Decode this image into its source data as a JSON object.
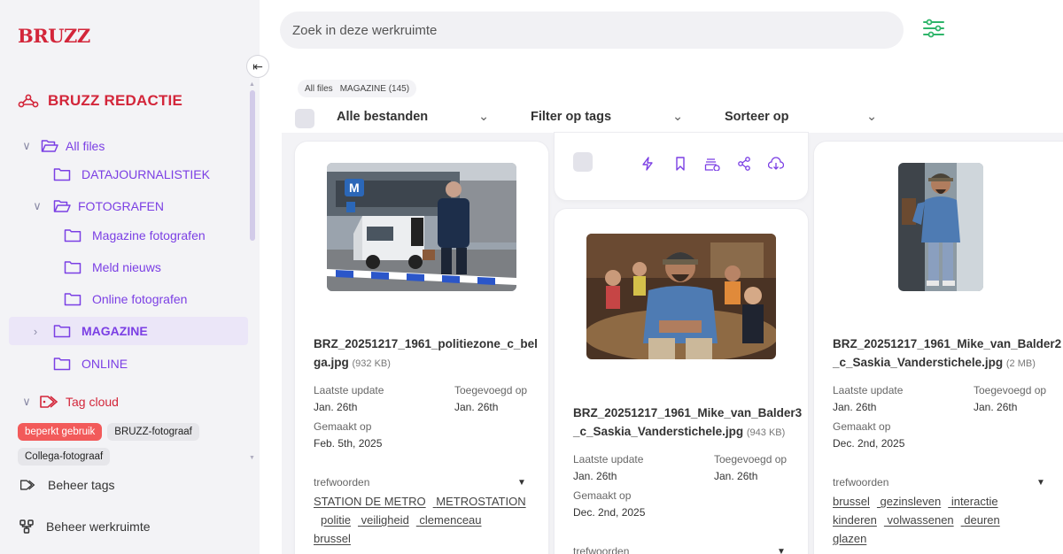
{
  "app": {
    "logo": "BRUZZ"
  },
  "sidebar": {
    "workspace": "BRUZZ REDACTIE",
    "tree": {
      "all_files": "All files",
      "datajournalistiek": "DATAJOURNALISTIEK",
      "fotografen": "FOTOGRAFEN",
      "magazine_fotografen": "Magazine fotografen",
      "meld_nieuws": "Meld nieuws",
      "online_fotografen": "Online fotografen",
      "magazine": "MAGAZINE",
      "online": "ONLINE"
    },
    "tag_cloud": "Tag cloud",
    "tags": [
      "beperkt gebruik",
      "BRUZZ-fotograaf",
      "Collega-fotograaf"
    ],
    "manage_tags": "Beheer tags",
    "manage_workspace": "Beheer werkruimte"
  },
  "search": {
    "placeholder": "Zoek in deze werkruimte"
  },
  "breadcrumb": {
    "root": "All files",
    "current": "MAGAZINE (145)"
  },
  "toolbar": {
    "all_files": "Alle bestanden",
    "filter_tags": "Filter op tags",
    "sort": "Sorteer op"
  },
  "cards": {
    "labels": {
      "updated": "Laatste update",
      "added": "Toegevoegd op",
      "created": "Gemaakt op",
      "keywords": "trefwoorden"
    },
    "card1": {
      "filename": "BRZ_20251217_1961_politiezone_c_belga.jpg",
      "filename_l1": "BRZ_20251217_1961_politiezone_c_bel",
      "filename_l2": "ga.jpg",
      "size": "(932 KB)",
      "updated": "Jan. 26th",
      "added": "Jan. 26th",
      "created": "Feb. 5th, 2025",
      "keywords": [
        "STATION DE METRO",
        "METROSTATION",
        "politie",
        "veiligheid",
        "clemenceau",
        "brussel"
      ]
    },
    "card2": {
      "filename_l1": "BRZ_20251217_1961_Mike_van_Balder3",
      "filename_l2": "_c_Saskia_Vanderstichele.jpg",
      "size": "(943 KB)",
      "updated": "Jan. 26th",
      "added": "Jan. 26th",
      "created": "Dec. 2nd, 2025"
    },
    "card3": {
      "filename_l1": "BRZ_20251217_1961_Mike_van_Balder2",
      "filename_l2": "_c_Saskia_Vanderstichele.jpg",
      "size": "(2 MB)",
      "updated": "Jan. 26th",
      "added": "Jan. 26th",
      "created": "Dec. 2nd, 2025",
      "keywords": [
        "brussel",
        "gezinsleven",
        "interactie",
        "kinderen",
        "volwassenen",
        "deuren",
        "glazen"
      ]
    }
  },
  "colors": {
    "brand": "#d3263a",
    "accent": "#7b3fe4"
  },
  "icons": [
    "collapse-sidebar-icon",
    "network-icon",
    "folder-icon",
    "tag-icon",
    "gear-tree-icon",
    "filter-lines-icon",
    "lightning-icon",
    "bookmark-icon",
    "add-to-collection-icon",
    "share-icon",
    "download-icon"
  ]
}
